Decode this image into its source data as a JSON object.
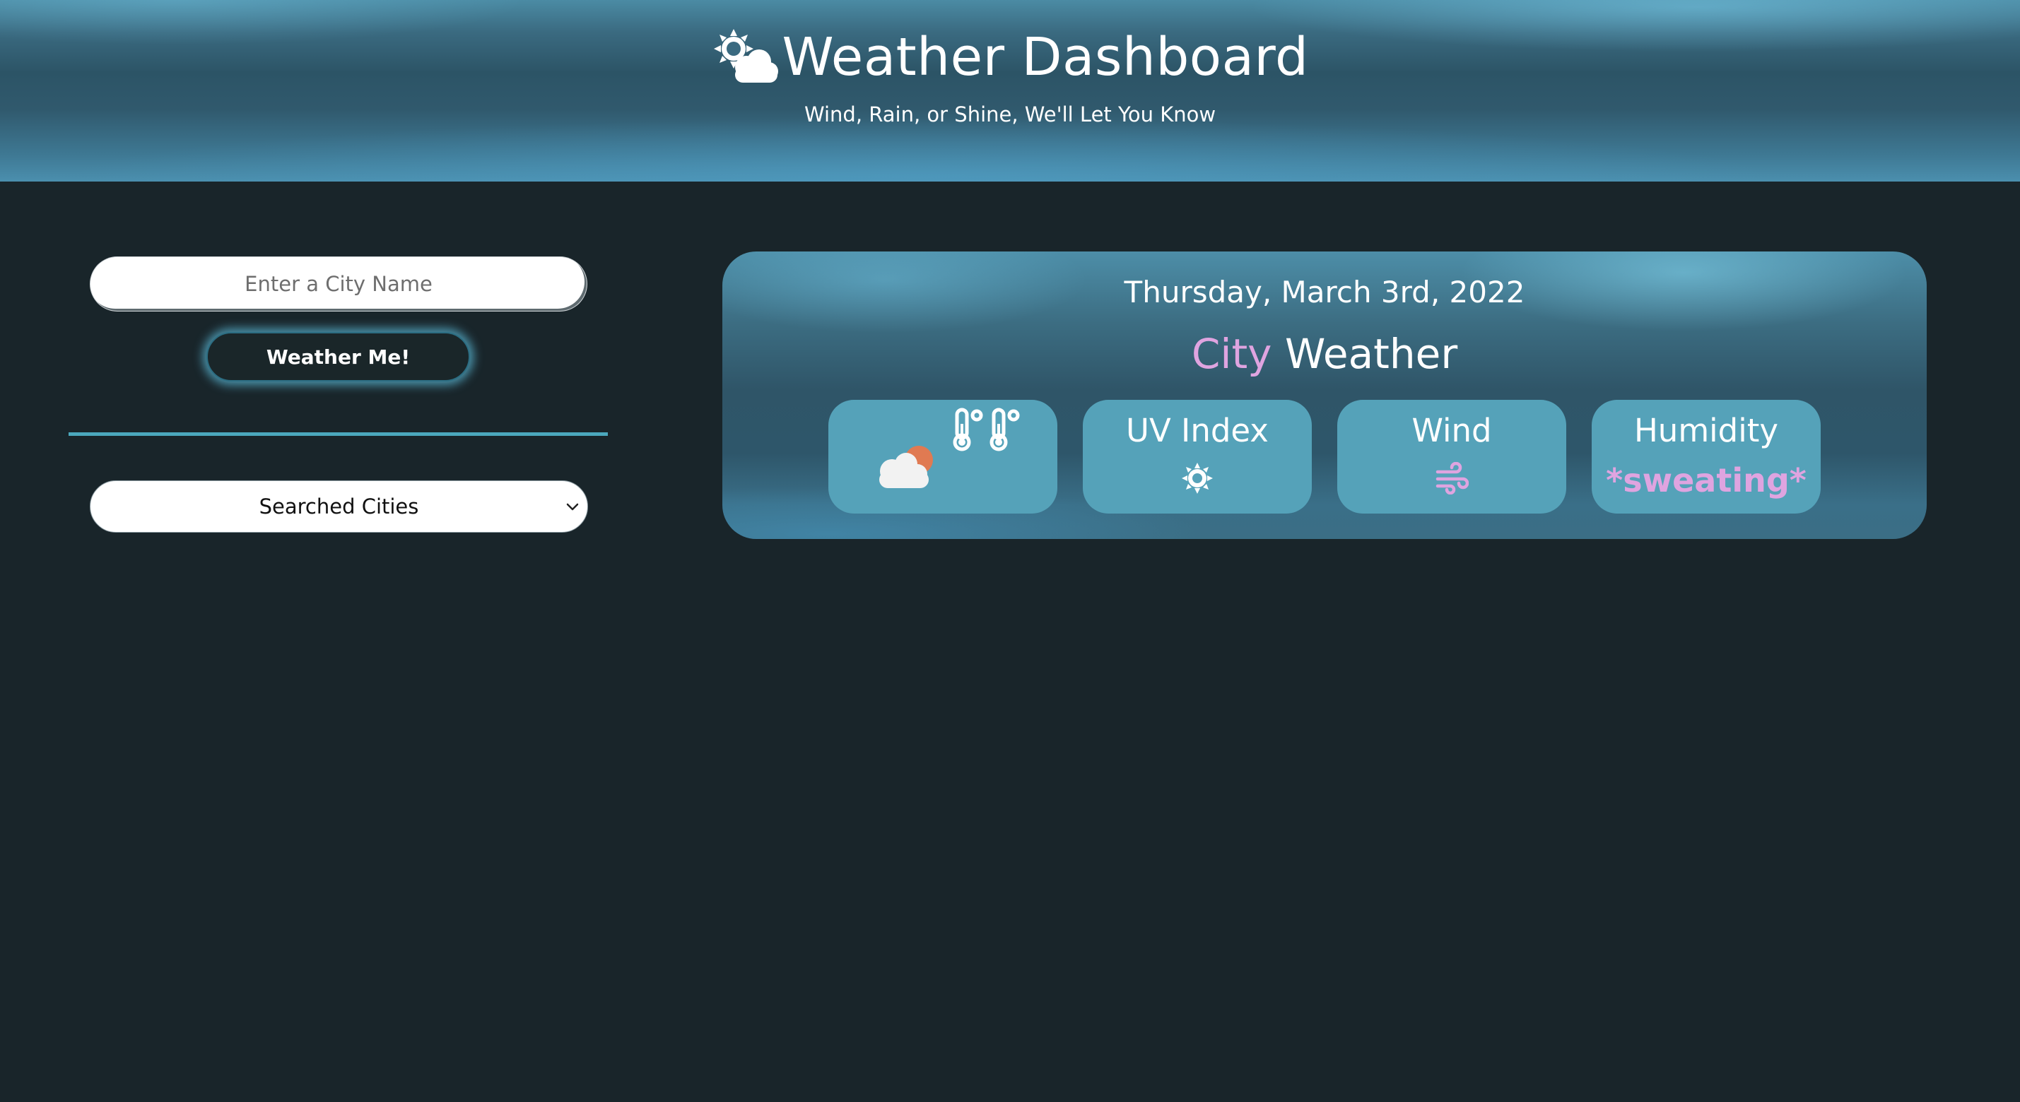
{
  "header": {
    "title": "Weather Dashboard",
    "subtitle": "Wind, Rain, or Shine, We'll Let You Know",
    "title_icon": "sun-cloud-icon"
  },
  "sidebar": {
    "search_placeholder": "Enter a City Name",
    "search_value": "",
    "search_button_label": "Weather Me!",
    "searched_cities_label": "Searched Cities"
  },
  "weather_card": {
    "date": "Thursday, March 3rd, 2022",
    "city_label": "City",
    "weather_label": "Weather",
    "condition_icon": "partly-cloudy-icon",
    "temperature_icons": "thermometer-degree-icon",
    "uv_index": {
      "title": "UV Index",
      "icon": "sun-icon"
    },
    "wind": {
      "title": "Wind",
      "icon": "wind-icon"
    },
    "humidity": {
      "title": "Humidity",
      "value": "*sweating*"
    }
  },
  "colors": {
    "background": "#19252a",
    "accent_pink": "#dfa4e0",
    "stat_box": "#55a2b9",
    "divider": "#4ba8bd",
    "cloud_sun": "#e07a52"
  }
}
